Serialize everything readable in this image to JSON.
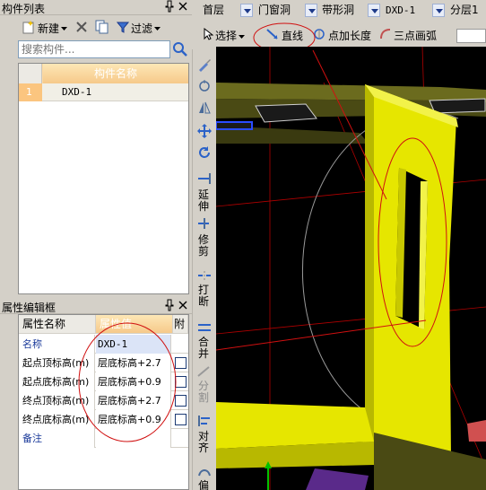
{
  "component_list": {
    "title": "构件列表",
    "pin_glyph": "ᵽ",
    "close_glyph": "×",
    "toolbar": {
      "new_label": "新建",
      "filter_label": "过滤"
    },
    "search_placeholder": "搜索构件...",
    "column_header": "构件名称",
    "rows": [
      {
        "num": "1",
        "name": "DXD-1"
      }
    ]
  },
  "property_editor": {
    "title": "属性编辑框",
    "headers": {
      "name": "属性名称",
      "value": "属性值",
      "extra": "附加"
    },
    "rows": [
      {
        "name": "名称",
        "value": "DXD-1",
        "highlight": true,
        "checkbox": false
      },
      {
        "name": "起点顶标高(m)",
        "value": "层底标高+2.7",
        "highlight": false,
        "checkbox": true
      },
      {
        "name": "起点底标高(m)",
        "value": "层底标高+0.9",
        "highlight": false,
        "checkbox": true
      },
      {
        "name": "终点顶标高(m)",
        "value": "层底标高+2.7",
        "highlight": false,
        "checkbox": true
      },
      {
        "name": "终点底标高(m)",
        "value": "层底标高+0.9",
        "highlight": false,
        "checkbox": true
      },
      {
        "name": "备注",
        "value": "",
        "highlight": true,
        "checkbox": false
      }
    ]
  },
  "top_combos": {
    "floor": "首层",
    "category": "门窗洞",
    "type": "带形洞",
    "component": "DXD-1",
    "layer": "分层1"
  },
  "draw_toolbar": {
    "select_label": "选择",
    "line_label": "直线",
    "point_length_label": "点加长度",
    "arc_label": "三点画弧"
  },
  "vertical_toolbar": {
    "extend_label": "延伸",
    "trim_label": "修剪",
    "break_label": "打断",
    "merge_label": "合并",
    "split_label": "分割",
    "align_label": "对齐",
    "offset_label": "偏"
  },
  "colors": {
    "wall_yellow": "#e6e600",
    "annotation_red": "#d01010",
    "grid_header_orange": "#f6c98a",
    "name_blue": "#1a3a9a",
    "highlight_blue_row": "#1f3fa0"
  },
  "icons": {
    "new": "new-component-icon",
    "delete": "delete-icon",
    "copy": "copy-icon",
    "filter": "filter-icon",
    "search": "search-icon",
    "select": "cursor-icon",
    "line": "line-draw-icon",
    "point_length": "point-length-icon",
    "arc": "arc-icon"
  }
}
